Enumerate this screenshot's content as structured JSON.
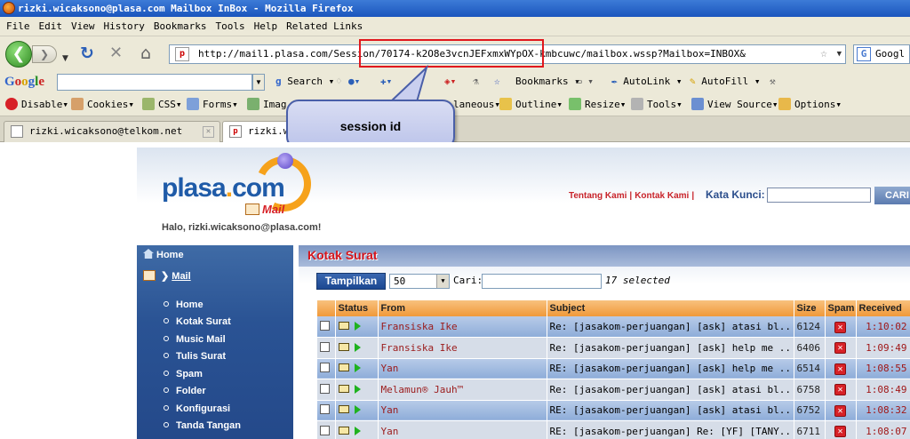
{
  "window": {
    "title": "rizki.wicaksono@plasa.com Mailbox InBox - Mozilla Firefox"
  },
  "menu": [
    "File",
    "Edit",
    "View",
    "History",
    "Bookmarks",
    "Tools",
    "Help",
    "Related Links"
  ],
  "navbar": {
    "url": "http://mail1.plasa.com/Session/70174-k2O8e3vcnJEFxmxWYpOX-kmbcuwc/mailbox.wssp?Mailbox=INBOX&",
    "search_engine_text": "Googl",
    "back_icon": "back-arrow-icon",
    "reload_icon": "reload-icon",
    "stop_icon": "stop-icon",
    "home_icon": "home-icon"
  },
  "google_toolbar": {
    "logo": "Google",
    "search_label": "Search",
    "bookmarks_label": "Bookmarks",
    "autolink_label": "AutoLink",
    "autofill_label": "AutoFill"
  },
  "dev_toolbar": {
    "items": [
      "Disable",
      "Cookies",
      "CSS",
      "Forms",
      "Imag",
      "laneous",
      "Outline",
      "Resize",
      "Tools",
      "View Source",
      "Options"
    ]
  },
  "tabs": [
    {
      "label": "rizki.wicaksono@telkom.net",
      "active": false
    },
    {
      "label": "rizki.w",
      "active": true
    }
  ],
  "annotation": {
    "label": "session id",
    "highlight_color": "#e0171d"
  },
  "site": {
    "logo_text": "plasa",
    "logo_dot": ".",
    "logo_com": "com",
    "logo_sub": "Mail",
    "greeting": "Halo, rizki.wicaksono@plasa.com!",
    "link_about": "Tentang Kami",
    "link_contact": "Kontak Kami",
    "keyword_label": "Kata Kunci:",
    "search_button": "CARI"
  },
  "sidebar": {
    "home": "Home",
    "mail": "Mail",
    "items": [
      "Home",
      "Kotak Surat",
      "Music Mail",
      "Tulis Surat",
      "Spam",
      "Folder",
      "Konfigurasi",
      "Tanda Tangan"
    ]
  },
  "inbox": {
    "title": "Kotak Surat",
    "show_button": "Tampilkan",
    "page_size": "50",
    "search_label": "Cari:",
    "selected_count": "17 selected",
    "columns": [
      "",
      "Status",
      "From",
      "Subject",
      "Size",
      "Spam",
      "Received"
    ],
    "rows": [
      {
        "from": "Fransiska Ike",
        "subject": "Re: [jasakom-perjuangan] [ask] atasi bl..",
        "size": "6124",
        "received": "1:10:02"
      },
      {
        "from": "Fransiska Ike",
        "subject": "Re: [jasakom-perjuangan] [ask] help me ..",
        "size": "6406",
        "received": "1:09:49"
      },
      {
        "from": "Yan",
        "subject": "RE: [jasakom-perjuangan] [ask] help me ..",
        "size": "6514",
        "received": "1:08:55"
      },
      {
        "from": "Melamun® Jauh™",
        "subject": "Re: [jasakom-perjuangan] [ask] atasi bl..",
        "size": "6758",
        "received": "1:08:49"
      },
      {
        "from": "Yan",
        "subject": "RE: [jasakom-perjuangan] [ask] atasi bl..",
        "size": "6752",
        "received": "1:08:32"
      },
      {
        "from": "Yan",
        "subject": "RE: [jasakom-perjuangan] Re: [YF] [TANY..",
        "size": "6711",
        "received": "1:08:07"
      }
    ]
  }
}
